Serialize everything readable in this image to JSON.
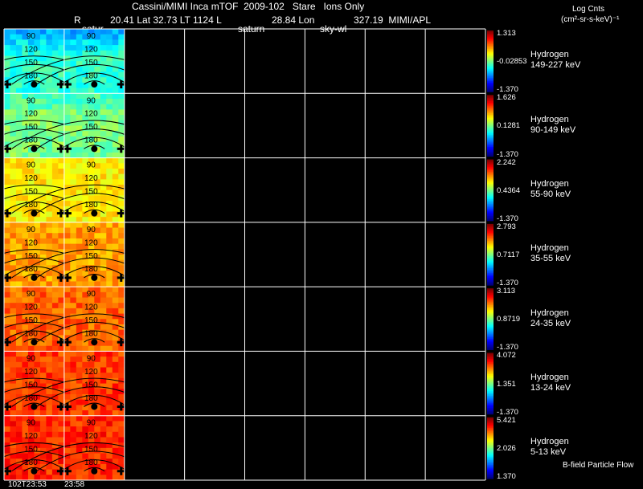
{
  "header": {
    "title": "Cassini/MIMI Inca mTOF  2009-102   Stare   Ions Only",
    "r_label": "R",
    "saturn_label_1": "satur",
    "coords": "20.41 Lat 32.73 LT 1124 L",
    "saturn_label_2": "saturn",
    "lon": "28.84 Lon",
    "sky_label": "sky-wl",
    "lon_value": "327.19  MIMI/APL",
    "units_line1": "Log Cnts",
    "units_line2": "(cm²-sr-s-keV)⁻¹"
  },
  "footer": {
    "time_start": "102T23:53",
    "time_end": "23:58",
    "flow_label": "B-field Particle Flow"
  },
  "chart_data": {
    "type": "heatmap",
    "panel_count_filled": 2,
    "grid_columns": 8,
    "angle_labels": [
      "90",
      "120",
      "150",
      "180"
    ],
    "bands": [
      {
        "species": "Hydrogen",
        "energy": "149-227 keV",
        "cb_max": "1.313",
        "cb_mid": "-0.02853",
        "cb_min": "-1.370"
      },
      {
        "species": "Hydrogen",
        "energy": "90-149 keV",
        "cb_max": "1.626",
        "cb_mid": "0.1281",
        "cb_min": "-1.370"
      },
      {
        "species": "Hydrogen",
        "energy": "55-90 keV",
        "cb_max": "2.242",
        "cb_mid": "0.4364",
        "cb_min": "-1.370"
      },
      {
        "species": "Hydrogen",
        "energy": "35-55 keV",
        "cb_max": "2.793",
        "cb_mid": "0.7117",
        "cb_min": "-1.370"
      },
      {
        "species": "Hydrogen",
        "energy": "24-35 keV",
        "cb_max": "3.113",
        "cb_mid": "0.8719",
        "cb_min": "-1.370"
      },
      {
        "species": "Hydrogen",
        "energy": "13-24 keV",
        "cb_max": "4.072",
        "cb_mid": "1.351",
        "cb_min": "-1.370"
      },
      {
        "species": "Hydrogen",
        "energy": "5-13 keV",
        "cb_max": "5.421",
        "cb_mid": "2.026",
        "cb_min": "1.370"
      }
    ],
    "band_intensity": [
      0.42,
      0.5,
      0.64,
      0.72,
      0.78,
      0.82,
      0.84
    ]
  }
}
